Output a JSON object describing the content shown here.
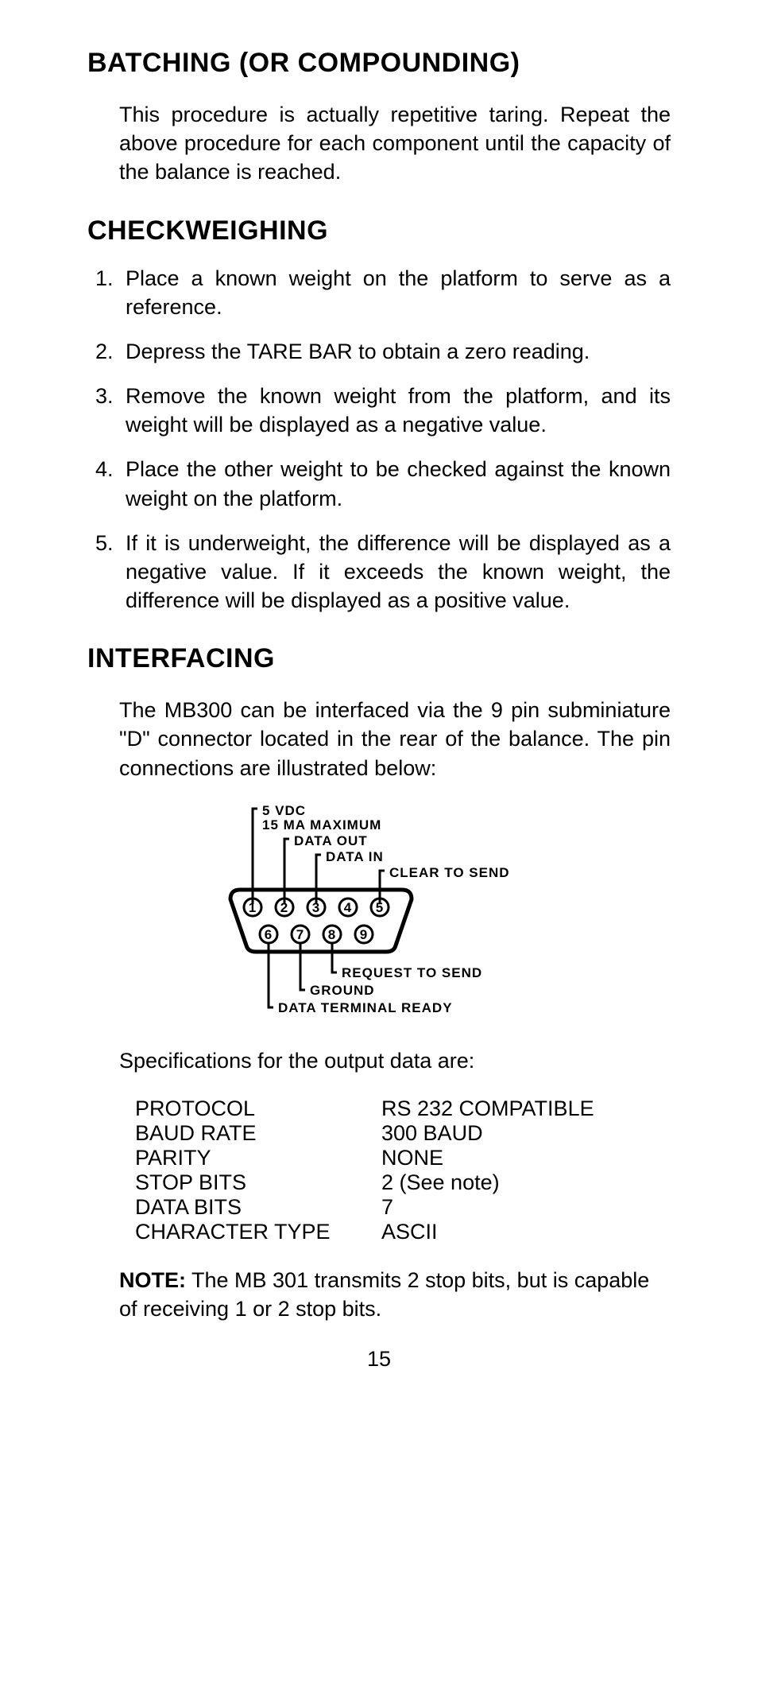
{
  "sections": {
    "batching": {
      "title": "BATCHING (OR COMPOUNDING)",
      "body": "This procedure is actually repetitive taring. Repeat the above procedure for each component until the capacity of the balance is reached."
    },
    "checkweighing": {
      "title": "CHECKWEIGHING",
      "steps": [
        "Place a known weight on the platform to serve as a reference.",
        "Depress the TARE BAR to obtain a zero reading.",
        "Remove the known weight from the platform, and its weight will be displayed as a negative value.",
        "Place the other weight to be checked against the known weight on the platform.",
        "If it is underweight, the difference will be displayed as a negative value. If it exceeds the known weight, the difference will be displayed as a positive value."
      ]
    },
    "interfacing": {
      "title": "INTERFACING",
      "intro": "The MB300 can be interfaced via the 9 pin subminiature \"D\" connector located in the rear of the balance. The pin connections are illustrated below:",
      "pins": {
        "top_header_line1": "5 VDC",
        "top_header_line2": "15 MA MAXIMUM",
        "p2": "DATA OUT",
        "p3": "DATA IN",
        "p5": "CLEAR TO SEND",
        "p6": "DATA TERMINAL READY",
        "p7": "GROUND",
        "p8": "REQUEST TO SEND"
      },
      "spec_intro": "Specifications for the output data are:",
      "specs": [
        {
          "k": "PROTOCOL",
          "v": "RS 232 COMPATIBLE"
        },
        {
          "k": "BAUD RATE",
          "v": "300 BAUD"
        },
        {
          "k": "PARITY",
          "v": "NONE"
        },
        {
          "k": "STOP BITS",
          "v": "2 (See note)"
        },
        {
          "k": "DATA BITS",
          "v": "7"
        },
        {
          "k": "CHARACTER TYPE",
          "v": "ASCII"
        }
      ],
      "note_label": "NOTE:",
      "note_body": " The MB 301 transmits 2 stop bits, but is capable of receiving 1 or 2 stop bits."
    }
  },
  "page_number": "15"
}
